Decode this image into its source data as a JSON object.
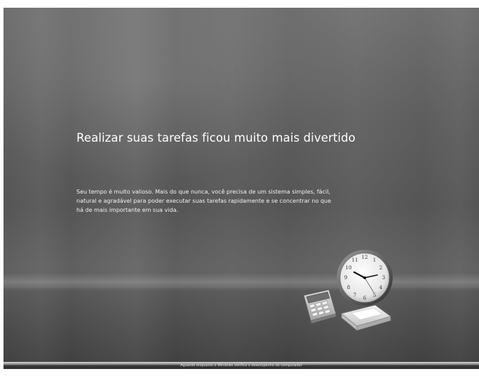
{
  "slide": {
    "headline": "Realizar suas tarefas ficou muito mais divertido",
    "body": "Seu tempo é muito valioso. Mais do que nunca, você precisa de um sistema simples, fácil, natural e agradável para poder executar suas tarefas rapidamente e se concentrar no que há de mais importante em sua vida.",
    "illustration": {
      "icons": [
        "clock-icon",
        "calculator-icon",
        "inbox-tray-icon"
      ],
      "clock_numerals": [
        "12",
        "1",
        "2",
        "3",
        "4",
        "5",
        "6",
        "7",
        "8",
        "9",
        "10",
        "11"
      ]
    }
  },
  "status_bar": {
    "text": "Aguarde enquanto o Windows verifica o desempenho do computador"
  },
  "colors": {
    "background": "#5e5e5e",
    "text": "#ffffff",
    "status_bar": "#2b2b2b"
  }
}
